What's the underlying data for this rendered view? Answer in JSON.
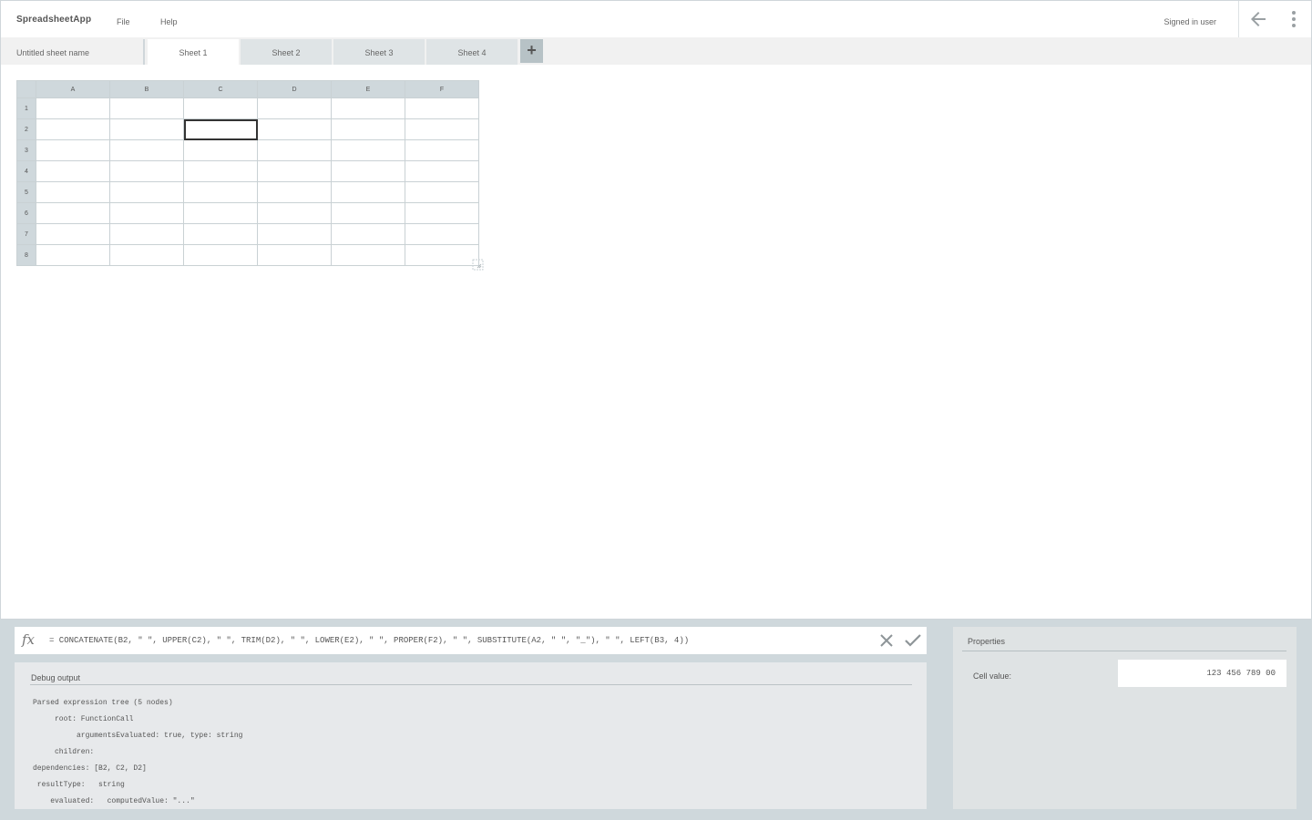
{
  "header": {
    "brand": "SpreadsheetApp",
    "menu": [
      "File",
      "Help"
    ],
    "user_label": "Signed in user"
  },
  "tabs_bar": {
    "document_name": "Untitled sheet name",
    "sheets": [
      {
        "label": "Sheet 1",
        "active": true
      },
      {
        "label": "Sheet 2",
        "active": false
      },
      {
        "label": "Sheet 3",
        "active": false
      },
      {
        "label": "Sheet 4",
        "active": false
      }
    ],
    "add_label": "+"
  },
  "grid": {
    "columns": [
      "A",
      "B",
      "C",
      "D",
      "E",
      "F"
    ],
    "rows": [
      "1",
      "2",
      "3",
      "4",
      "5",
      "6",
      "7",
      "8"
    ],
    "cells": [
      [
        "",
        "",
        "",
        "",
        "",
        ""
      ],
      [
        "",
        "",
        "",
        "",
        "",
        ""
      ],
      [
        "",
        "",
        "",
        "",
        "",
        ""
      ],
      [
        "",
        "",
        "",
        "",
        "",
        ""
      ],
      [
        "",
        "",
        "",
        "",
        "",
        ""
      ],
      [
        "",
        "",
        "",
        "",
        "",
        ""
      ],
      [
        "",
        "",
        "",
        "",
        "",
        ""
      ],
      [
        "",
        "",
        "",
        "",
        "",
        ""
      ]
    ],
    "selected_cell": {
      "row": 2,
      "col": "C"
    }
  },
  "formula_bar": {
    "fx_label": "fx",
    "value": "= CONCATENATE(B2, \" \", UPPER(C2), \" \", TRIM(D2), \" \", LOWER(E2), \" \", PROPER(F2), \" \", SUBSTITUTE(A2, \" \", \"_\"), \" \", LEFT(B3, 4))"
  },
  "debug_panel": {
    "title": "Debug output",
    "lines": [
      "Parsed expression tree (5 nodes)",
      "     root: FunctionCall",
      "          argumentsEvaluated: true, type: string",
      "     children:",
      "dependencies: [B2, C2, D2]",
      " resultType:   string",
      "    evaluated:   computedValue: \"...\""
    ]
  },
  "properties_panel": {
    "title": "Properties",
    "field_label": "Cell value:",
    "field_value": "123 456 789 00"
  },
  "colors": {
    "workspace": "#cfd8dc",
    "app_bg": "#ffffff",
    "tabs_bg": "#f1f1f1",
    "inactive_tab": "#dfe4e6",
    "header_cell": "#cfd8dc",
    "selection_border": "#333333"
  },
  "icons": [
    "fx-icon",
    "back-arrow-icon",
    "more-vert-icon",
    "close-icon",
    "check-icon",
    "plus-icon",
    "resize-handle-icon"
  ]
}
